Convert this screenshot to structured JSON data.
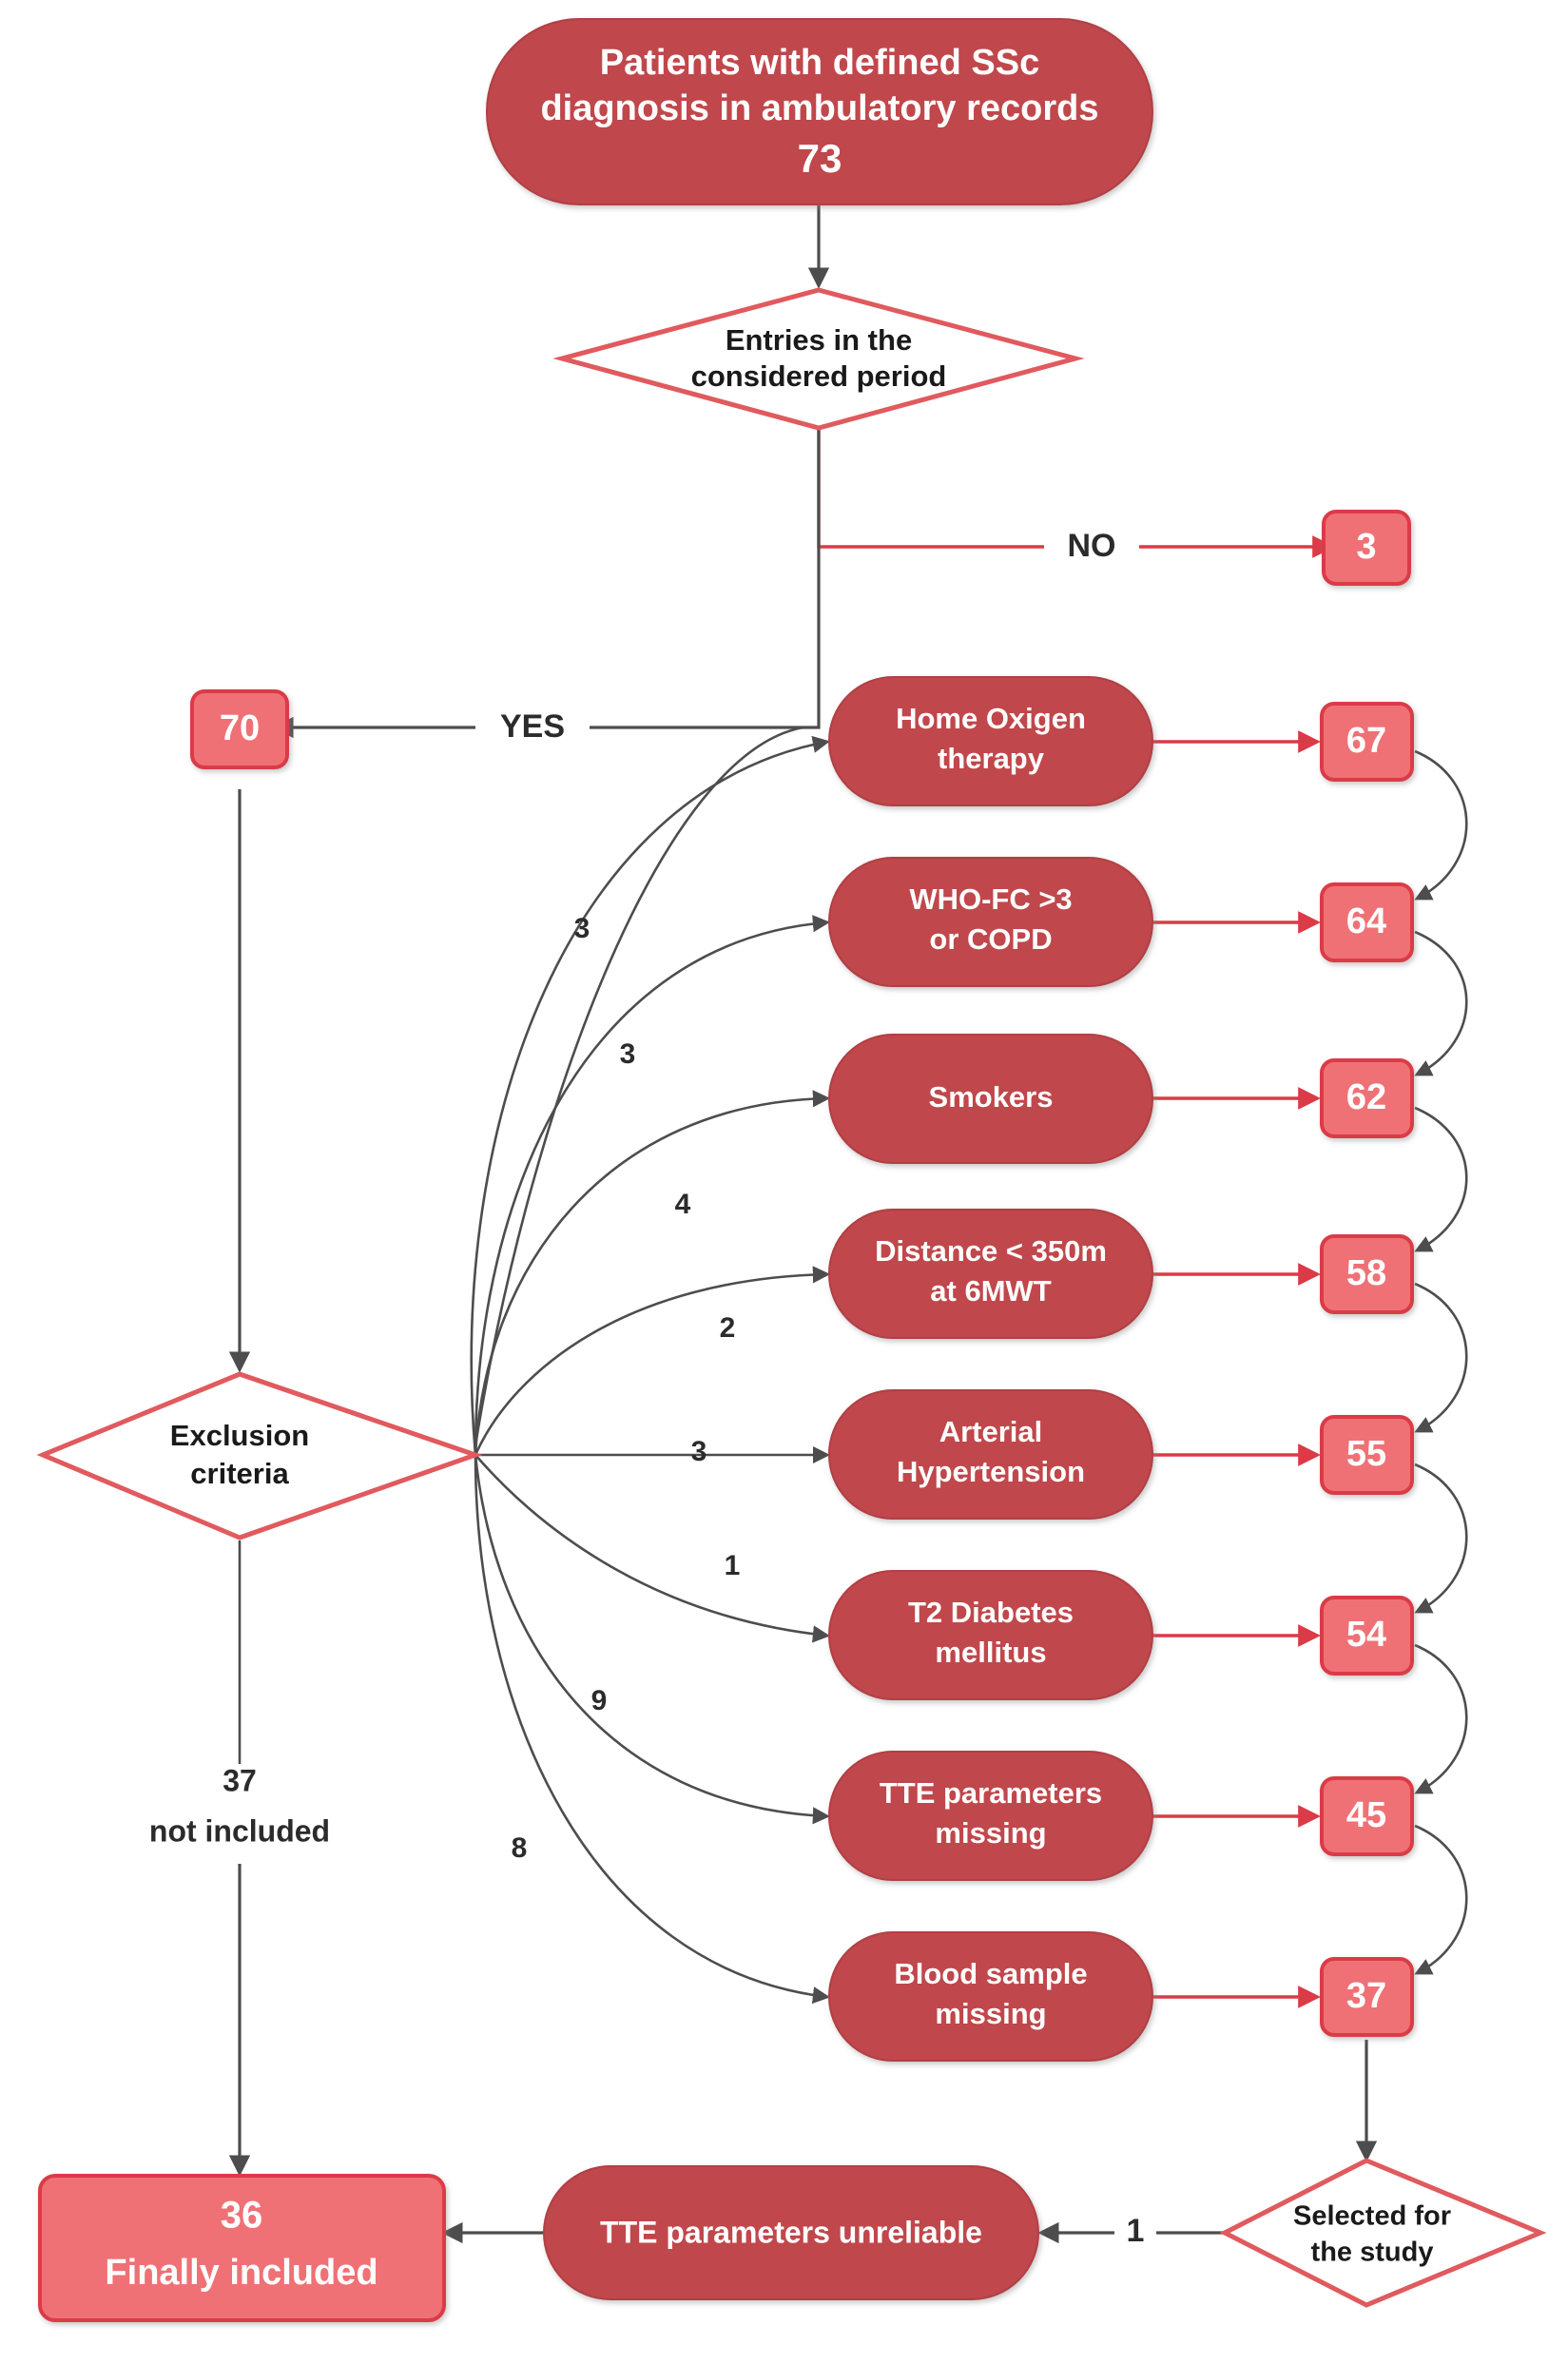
{
  "diagram": {
    "title": "SSc patient selection flowchart",
    "colors": {
      "node_fill_dark": "#c0474c",
      "node_fill_light": "#ef7174",
      "node_stroke_red": "#db3b46",
      "diamond_stroke": "#e05a5e",
      "arrow_gray": "#4d4d4d",
      "arrow_red": "#db3b46",
      "text_white": "#ffffff",
      "text_dark": "#1a1a1a",
      "background": "#ffffff"
    },
    "start": {
      "line1": "Patients with defined SSc",
      "line2": "diagnosis in ambulatory records",
      "count": "73"
    },
    "decision_entries": {
      "line1": "Entries in the",
      "line2": "considered period",
      "branch_no": "NO",
      "branch_yes": "YES",
      "no_count": "3",
      "yes_count": "70"
    },
    "decision_exclusion": {
      "line1": "Exclusion",
      "line2": "criteria"
    },
    "decision_selected": {
      "line1": "Selected for",
      "line2": "the study",
      "edge_label": "1"
    },
    "exclusion_steps": [
      {
        "line1": "Home Oxigen",
        "line2": "therapy",
        "edge_count": "3",
        "remaining": "67"
      },
      {
        "line1": "WHO-FC >3",
        "line2": "or COPD",
        "edge_count": "3",
        "remaining": "64"
      },
      {
        "line1": "Smokers",
        "line2": "",
        "edge_count": "4",
        "remaining": "62"
      },
      {
        "line1": "Distance < 350m",
        "line2": "at 6MWT",
        "edge_count": "2",
        "remaining": "58"
      },
      {
        "line1": "Arterial",
        "line2": "Hypertension",
        "edge_count": "3",
        "remaining": "55"
      },
      {
        "line1": "T2 Diabetes",
        "line2": "mellitus",
        "edge_count": "1",
        "remaining": "54"
      },
      {
        "line1": "TTE parameters",
        "line2": "missing",
        "edge_count": "9",
        "remaining": "45"
      },
      {
        "line1": "Blood sample",
        "line2": "missing",
        "edge_count": "8",
        "remaining": "37"
      }
    ],
    "not_included": {
      "count": "37",
      "label": "not included"
    },
    "unreliable_node": {
      "label": "TTE parameters unreliable"
    },
    "final": {
      "count": "36",
      "label": "Finally included"
    }
  }
}
